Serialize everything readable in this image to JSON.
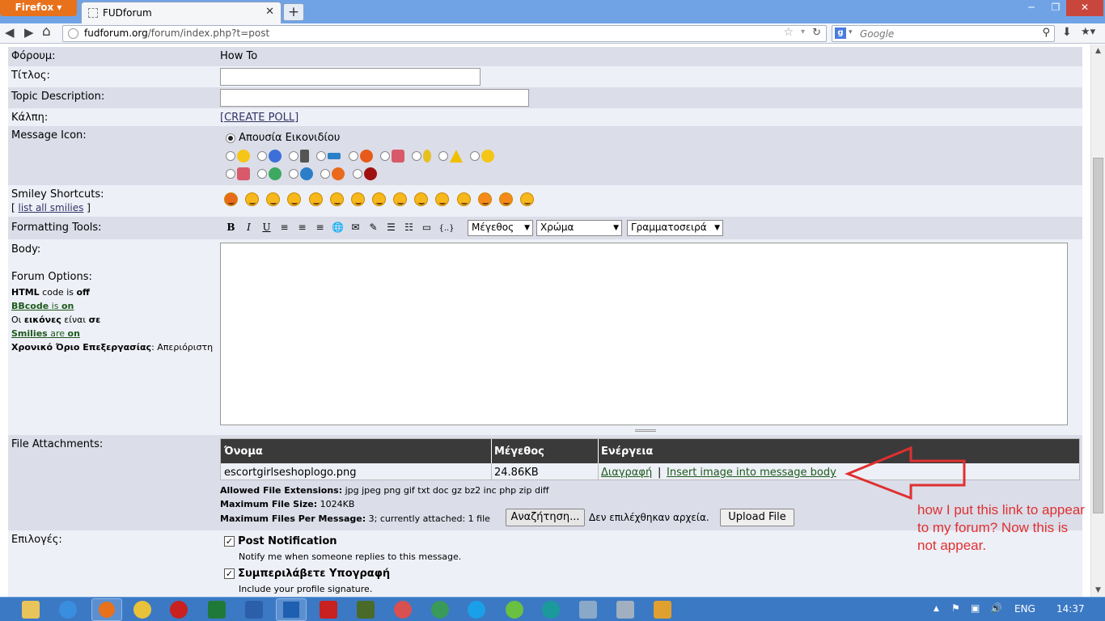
{
  "browser": {
    "menu_label": "Firefox",
    "tab_title": "FUDforum",
    "new_tab": "+",
    "url_host": "fudforum.org",
    "url_path": "/forum/index.php?t=post",
    "search_placeholder": "Google",
    "search_engine_letter": "g",
    "btn_min": "─",
    "btn_max": "❐",
    "btn_close": "✕",
    "btn_back": "◀",
    "btn_forward": "▶",
    "btn_home": "⌂",
    "btn_bookmark": "☆",
    "btn_reload": "↻",
    "btn_search": "⚲",
    "btn_download": "⬇",
    "btn_bookmarks_menu": "★▾",
    "scroll_up": "▲",
    "scroll_down": "▼"
  },
  "form": {
    "forum_label": "Φόρουμ:",
    "forum_value": "How To",
    "title_label": "Τίτλος:",
    "title_value": "",
    "desc_label": "Topic Description:",
    "desc_value": "",
    "poll_label": "Κάλπη:",
    "poll_link": "[CREATE POLL]",
    "icon_label": "Message Icon:",
    "icon_none": "Απουσία Εικονιδίου",
    "smiley_label": "Smiley Shortcuts:",
    "smiley_link_open": "[",
    "smiley_link": "list all smilies",
    "smiley_link_close": "]",
    "format_label": "Formatting Tools:",
    "format_buttons": [
      "B",
      "I",
      "U",
      "≡",
      "≡",
      "≡",
      "🌐",
      "✉",
      "✎",
      "☰",
      "☷",
      "▭",
      "{..}"
    ],
    "sel_size": "Μέγεθος",
    "sel_color": "Χρώμα",
    "sel_font": "Γραμματοσειρά",
    "body_label": "Body:",
    "options_heading": "Forum Options:",
    "opt_html_a": "HTML",
    "opt_html_b": " code is ",
    "opt_html_c": "off",
    "opt_bb_a": "BBcode",
    "opt_bb_b": " is ",
    "opt_bb_c": "on",
    "opt_img_a": "Οι ",
    "opt_img_b": "εικόνες",
    "opt_img_c": " είναι ",
    "opt_img_d": "σε",
    "opt_sm_a": "Smilies",
    "opt_sm_b": " are ",
    "opt_sm_c": "on",
    "opt_time_a": "Χρονικό Όριο Επεξεργασίας",
    "opt_time_b": ": Απεριόριστη",
    "att_label": "File Attachments:",
    "att_columns": [
      "Όνομα",
      "Μέγεθος",
      "Ενέργεια"
    ],
    "att_filename": "escortgirlseshoplogo.png",
    "att_size": "24.86KB",
    "att_delete": "Διαγραφή",
    "att_sep": "|",
    "att_insert": "Insert image into message body",
    "allowed_label": "Allowed File Extensions:",
    "allowed_value": " jpg jpeg png gif txt doc gz bz2 inc php zip diff",
    "maxsize_label": "Maximum File Size:",
    "maxsize_value": " 1024KB",
    "maxfiles_label": "Maximum Files Per Message:",
    "maxfiles_value": " 3; currently attached: 1 file",
    "browse_btn": "Αναζήτηση...",
    "no_file": "Δεν επιλέχθηκαν αρχεία.",
    "upload_btn": "Upload File",
    "options_label": "Επιλογές:",
    "notify_title": "Post Notification",
    "notify_desc": "Notify me when someone replies to this message.",
    "sig_title": "Συμπεριλάβετε Υπογραφή",
    "sig_desc": "Include your profile signature.",
    "check_mark": "✓"
  },
  "annotation": {
    "text": "how I put this link to appear to my forum? Now this is not appear."
  },
  "taskbar": {
    "lang": "ENG",
    "clock": "14:37",
    "tray_up": "▲",
    "tray_flag": "⚑",
    "tray_net": "▣",
    "tray_vol": "🔊"
  },
  "colors": {
    "accent": "#3b79c4",
    "annotation": "#e03030",
    "header_dark": "#3a3a3a"
  }
}
